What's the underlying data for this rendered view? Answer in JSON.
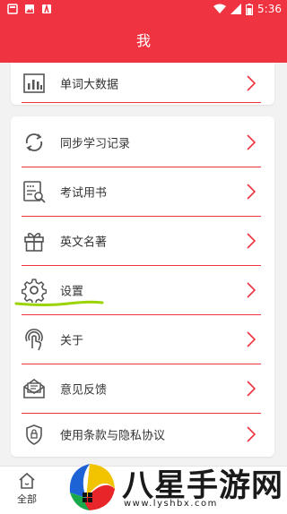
{
  "status_bar": {
    "time": "5:36"
  },
  "app_bar": {
    "title": "我"
  },
  "menu_top": {
    "label": "单词大数据"
  },
  "menu": [
    {
      "label": "同步学习记录"
    },
    {
      "label": "考试用书"
    },
    {
      "label": "英文名著"
    },
    {
      "label": "设置"
    },
    {
      "label": "关于"
    },
    {
      "label": "意见反馈"
    },
    {
      "label": "使用条款与隐私协议"
    }
  ],
  "bottom_nav": {
    "home_label": "全部"
  },
  "watermark": {
    "text": "八星手游网",
    "sub": "www.lyshbx.com"
  },
  "colors": {
    "accent": "#ef3340",
    "highlight": "#9bd400"
  }
}
